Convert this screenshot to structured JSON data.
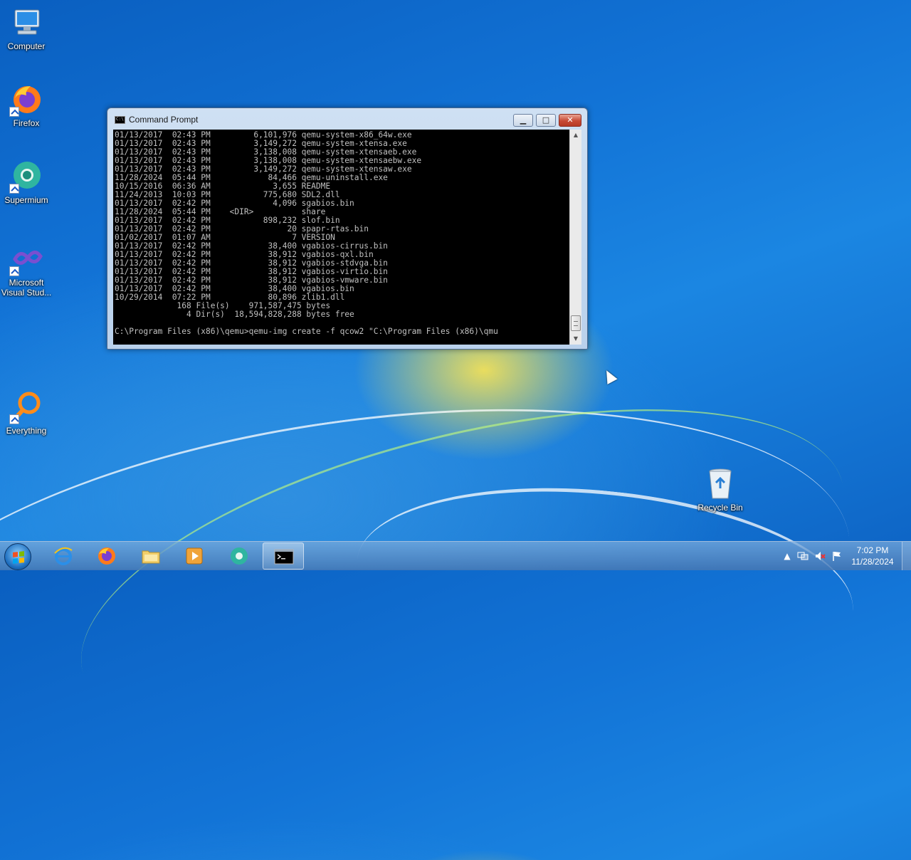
{
  "desktop": {
    "icons": [
      {
        "label": "Computer",
        "icon": "computer-icon"
      },
      {
        "label": "Firefox",
        "icon": "firefox-icon"
      },
      {
        "label": "Supermium",
        "icon": "supermium-icon"
      },
      {
        "label": "Microsoft\nVisual Stud...",
        "icon": "visual-studio-icon"
      },
      {
        "label": "Everything",
        "icon": "everything-search-icon"
      },
      {
        "label": "Recycle Bin",
        "icon": "recycle-bin-icon"
      }
    ]
  },
  "window": {
    "title": "Command Prompt",
    "lines": [
      "01/13/2017  02:43 PM         6,101,976 qemu-system-x86_64w.exe",
      "01/13/2017  02:43 PM         3,149,272 qemu-system-xtensa.exe",
      "01/13/2017  02:43 PM         3,138,008 qemu-system-xtensaeb.exe",
      "01/13/2017  02:43 PM         3,138,008 qemu-system-xtensaebw.exe",
      "01/13/2017  02:43 PM         3,149,272 qemu-system-xtensaw.exe",
      "11/28/2024  05:44 PM            84,466 qemu-uninstall.exe",
      "10/15/2016  06:36 AM             3,655 README",
      "11/24/2013  10:03 PM           775,680 SDL2.dll",
      "01/13/2017  02:42 PM             4,096 sgabios.bin",
      "11/28/2024  05:44 PM    <DIR>          share",
      "01/13/2017  02:42 PM           898,232 slof.bin",
      "01/13/2017  02:42 PM                20 spapr-rtas.bin",
      "01/02/2017  01:07 AM                 7 VERSION",
      "01/13/2017  02:42 PM            38,400 vgabios-cirrus.bin",
      "01/13/2017  02:42 PM            38,912 vgabios-qxl.bin",
      "01/13/2017  02:42 PM            38,912 vgabios-stdvga.bin",
      "01/13/2017  02:42 PM            38,912 vgabios-virtio.bin",
      "01/13/2017  02:42 PM            38,912 vgabios-vmware.bin",
      "01/13/2017  02:42 PM            38,400 vgabios.bin",
      "10/29/2014  07:22 PM            80,896 zlib1.dll",
      "             168 File(s)    971,587,475 bytes",
      "               4 Dir(s)  18,594,828,288 bytes free",
      "",
      "C:\\Program Files (x86)\\qemu>qemu-img create -f qcow2 \"C:\\Program Files (x86)\\qmu"
    ],
    "buttons": {
      "minimize": "▁",
      "maximize": "□",
      "close": "✕"
    }
  },
  "taskbar": {
    "pinned": [
      {
        "name": "internet-explorer",
        "icon": "internet-explorer-icon"
      },
      {
        "name": "firefox",
        "icon": "firefox-icon"
      },
      {
        "name": "file-explorer",
        "icon": "folder-icon"
      },
      {
        "name": "media-player",
        "icon": "media-player-icon"
      },
      {
        "name": "supermium",
        "icon": "supermium-icon"
      },
      {
        "name": "command-prompt",
        "icon": "command-prompt-icon",
        "active": true
      }
    ],
    "clock": {
      "time": "7:02 PM",
      "date": "11/28/2024"
    },
    "tray_icons": [
      "show-hidden-icons-icon",
      "network-icon",
      "volume-muted-icon",
      "action-center-flag-icon"
    ]
  }
}
